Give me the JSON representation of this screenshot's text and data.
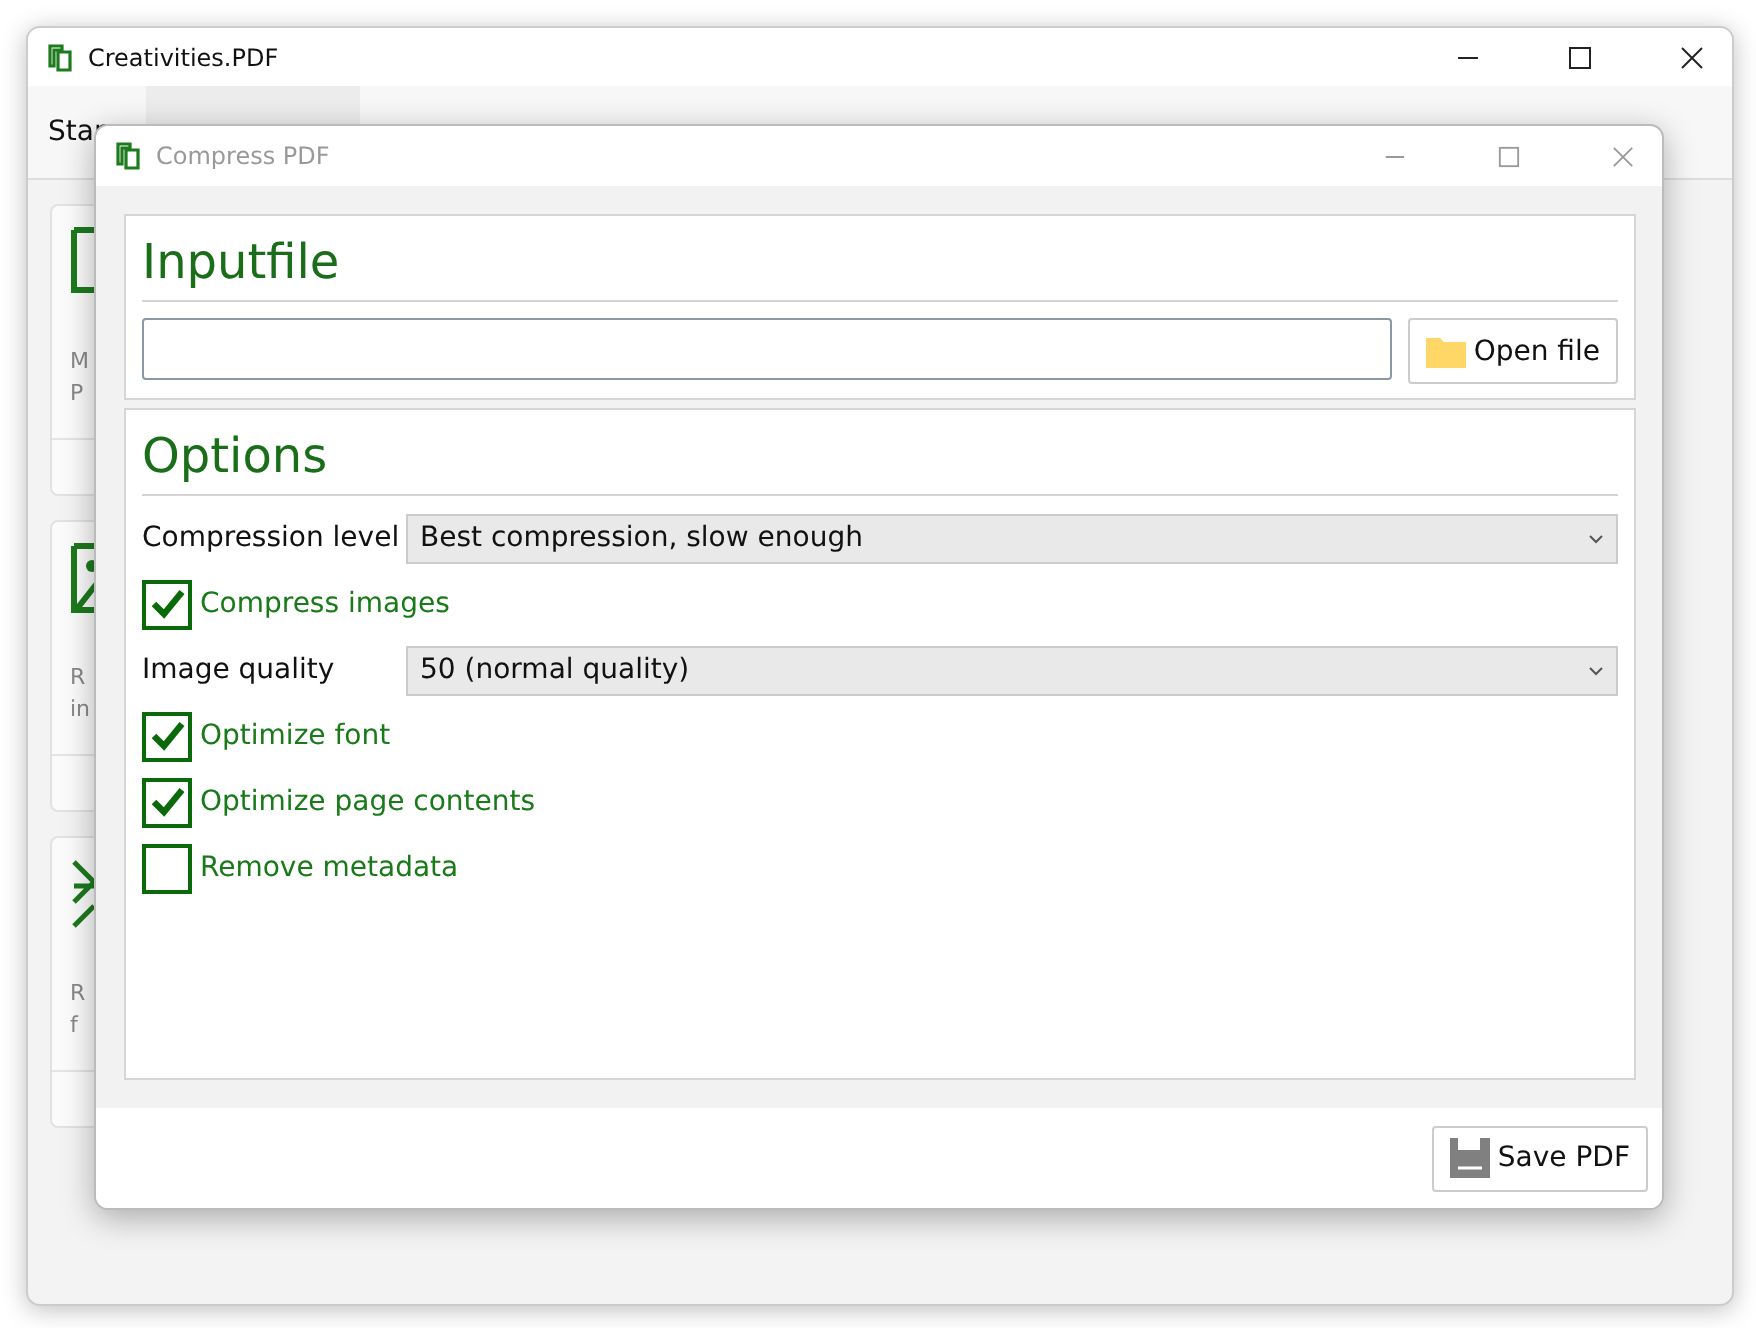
{
  "main_window": {
    "title": "Creativities.PDF",
    "tabs": [
      "Star"
    ],
    "cards": [
      {
        "kind": "pages",
        "lines": [
          "M",
          "P"
        ]
      },
      {
        "kind": "image",
        "lines": [
          "R",
          "in"
        ]
      },
      {
        "kind": "arrows",
        "lines": [
          "R",
          "f"
        ]
      }
    ]
  },
  "dialog": {
    "title": "Compress PDF",
    "input_section": {
      "heading": "Inputfile",
      "open_button": "Open file"
    },
    "options": {
      "heading": "Options",
      "rows": [
        {
          "kind": "select",
          "label": "Compression level",
          "value": "Best compression, slow enough"
        },
        {
          "kind": "checkbox",
          "label": "Compress images",
          "checked": true
        },
        {
          "kind": "select",
          "label": "Image quality",
          "value": "50 (normal quality)"
        },
        {
          "kind": "checkbox",
          "label": "Optimize font",
          "checked": true
        },
        {
          "kind": "checkbox",
          "label": "Optimize page contents",
          "checked": true
        },
        {
          "kind": "checkbox",
          "label": "Remove metadata",
          "checked": false
        }
      ]
    },
    "save_button": "Save PDF"
  }
}
